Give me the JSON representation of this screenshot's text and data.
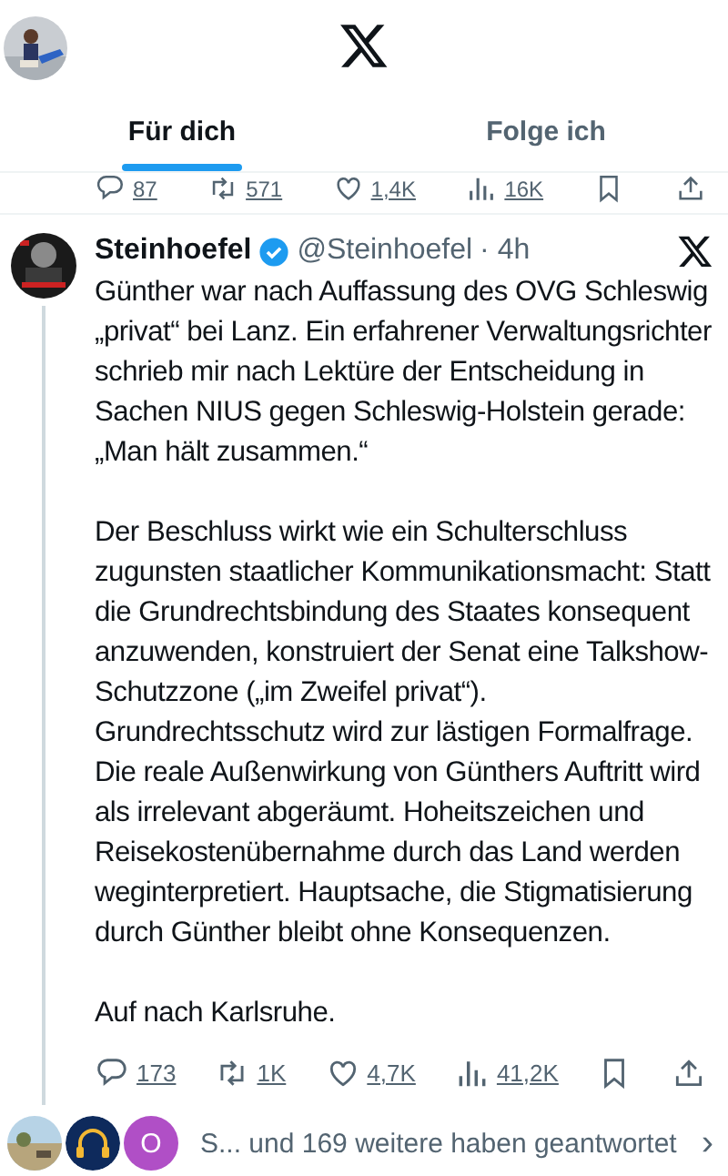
{
  "tabs": [
    {
      "label": "Für dich",
      "selected": true
    },
    {
      "label": "Folge ich",
      "selected": false
    }
  ],
  "previous_actions": [
    {
      "kind": "reply",
      "count": "87"
    },
    {
      "kind": "repost",
      "count": "571"
    },
    {
      "kind": "like",
      "count": "1,4K"
    },
    {
      "kind": "views",
      "count": "16K"
    },
    {
      "kind": "bookmark"
    },
    {
      "kind": "share"
    }
  ],
  "tweet": {
    "name": "Steinhoefel",
    "handle": "@Steinhoefel",
    "time": "· 4h",
    "verified": true,
    "paragraphs": [
      "Günther war nach Auffassung des OVG Schleswig „privat“ bei Lanz. Ein erfahrener Verwaltungsrichter schrieb mir nach Lektüre der Entscheidung in Sachen NIUS gegen Schleswig-Holstein gerade: „Man hält zusammen.“",
      "Der Beschluss wirkt wie ein Schulterschluss zugunsten staatlicher Kommunikationsmacht: Statt die Grundrechtsbindung des Staates konsequent anzuwenden, konstruiert der Senat eine Talkshow-Schutzzone („im Zweifel privat“). Grundrechtsschutz wird zur lästigen Formalfrage. Die reale Außenwirkung von Günthers Auftritt wird als irrelevant abgeräumt. Hoheitszeichen und Reisekostenübernahme durch das Land werden weginterpretiert. Hauptsache, die Stigmatisierung durch Günther bleibt ohne Konsequenzen.",
      "Auf nach Karlsruhe."
    ],
    "actions": [
      {
        "kind": "reply",
        "count": "173"
      },
      {
        "kind": "repost",
        "count": "1K"
      },
      {
        "kind": "like",
        "count": "4,7K"
      },
      {
        "kind": "views",
        "count": "41,2K"
      },
      {
        "kind": "bookmark"
      },
      {
        "kind": "share"
      }
    ]
  },
  "replies": {
    "avatars": [
      {
        "kind": "picture"
      },
      {
        "kind": "logo"
      },
      {
        "kind": "letter",
        "letter": "O",
        "color": "#b04fc6"
      }
    ],
    "text": "S... und 169 weitere haben geantwortet",
    "chevron": "›"
  }
}
